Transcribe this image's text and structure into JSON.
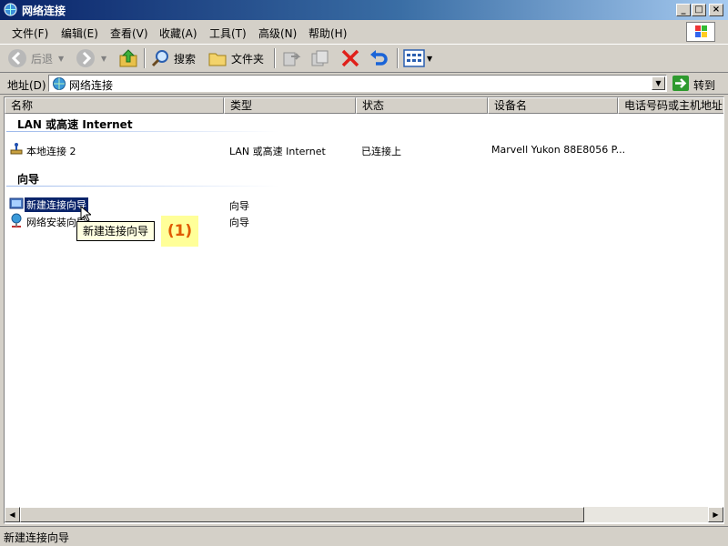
{
  "window": {
    "title": "网络连接"
  },
  "menu": {
    "items": [
      "文件(F)",
      "编辑(E)",
      "查看(V)",
      "收藏(A)",
      "工具(T)",
      "高级(N)",
      "帮助(H)"
    ]
  },
  "toolbar": {
    "back": "后退",
    "search": "搜索",
    "folders": "文件夹"
  },
  "address": {
    "label": "地址(D)",
    "value": "网络连接",
    "go": "转到"
  },
  "columns": [
    "名称",
    "类型",
    "状态",
    "设备名",
    "电话号码或主机地址"
  ],
  "groups": [
    {
      "title": "LAN 或高速 Internet",
      "rows": [
        {
          "name": "本地连接 2",
          "type": "LAN 或高速 Internet",
          "status": "已连接上",
          "device": "Marvell Yukon 88E8056 P..."
        }
      ]
    },
    {
      "title": "向导",
      "rows": [
        {
          "name": "新建连接向导",
          "type": "向导"
        },
        {
          "name": "网络安装向导",
          "type": "向导"
        }
      ]
    }
  ],
  "tooltip": "新建连接向导",
  "annotation": "(1)",
  "statusbar": "新建连接向导"
}
